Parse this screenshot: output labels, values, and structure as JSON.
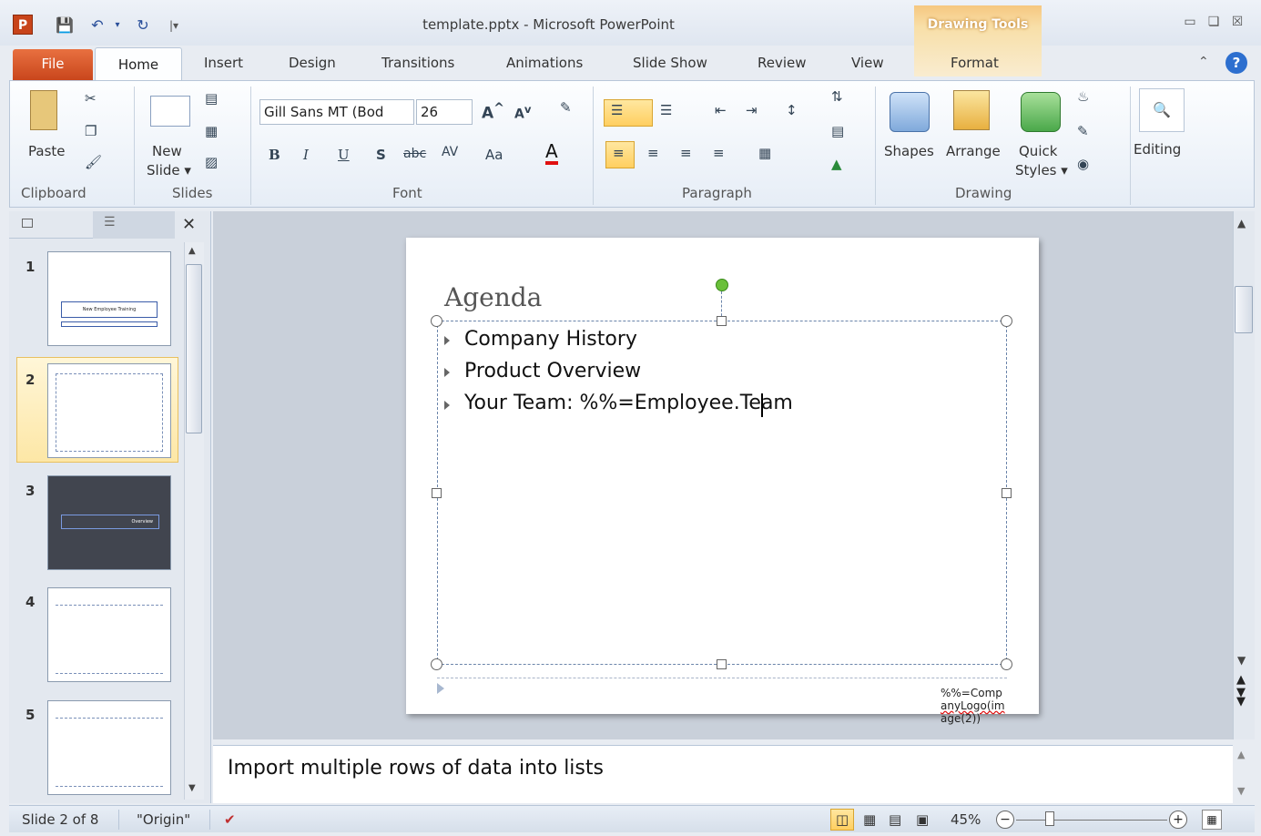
{
  "window": {
    "title": "template.pptx - Microsoft PowerPoint",
    "context_label": "Drawing Tools"
  },
  "tabs": [
    "File",
    "Home",
    "Insert",
    "Design",
    "Transitions",
    "Animations",
    "Slide Show",
    "Review",
    "View",
    "Format"
  ],
  "ribbon": {
    "clipboard": {
      "paste": "Paste",
      "label": "Clipboard"
    },
    "slides": {
      "new_slide_1": "New",
      "new_slide_2": "Slide ▾",
      "label": "Slides"
    },
    "font": {
      "family": "Gill Sans MT (Bod",
      "size": "26",
      "label": "Font"
    },
    "paragraph": {
      "label": "Paragraph"
    },
    "drawing": {
      "shapes": "Shapes",
      "arrange": "Arrange",
      "quick_1": "Quick",
      "quick_2": "Styles ▾",
      "label": "Drawing"
    },
    "editing": {
      "label": "Editing"
    }
  },
  "slides_panel": {
    "numbers": [
      "1",
      "2",
      "3",
      "4",
      "5"
    ],
    "thumb1_title": "New Employee Training",
    "thumb3_title": "Overview"
  },
  "slide": {
    "title": "Agenda",
    "bullets": [
      "Company History",
      "Product Overview",
      "Your Team: %%=Employee.Team"
    ],
    "footer_lines": [
      "%%=Comp",
      "anyLogo(im",
      "age(2))"
    ]
  },
  "notes": {
    "text": "Import multiple rows of data into lists"
  },
  "status": {
    "slide_info": "Slide 2 of 8",
    "theme": "\"Origin\"",
    "zoom": "45%"
  },
  "colors": {
    "file_tab": "#c9461c",
    "accent_blue": "#2a4f9a",
    "context_orange": "#f6c780"
  }
}
